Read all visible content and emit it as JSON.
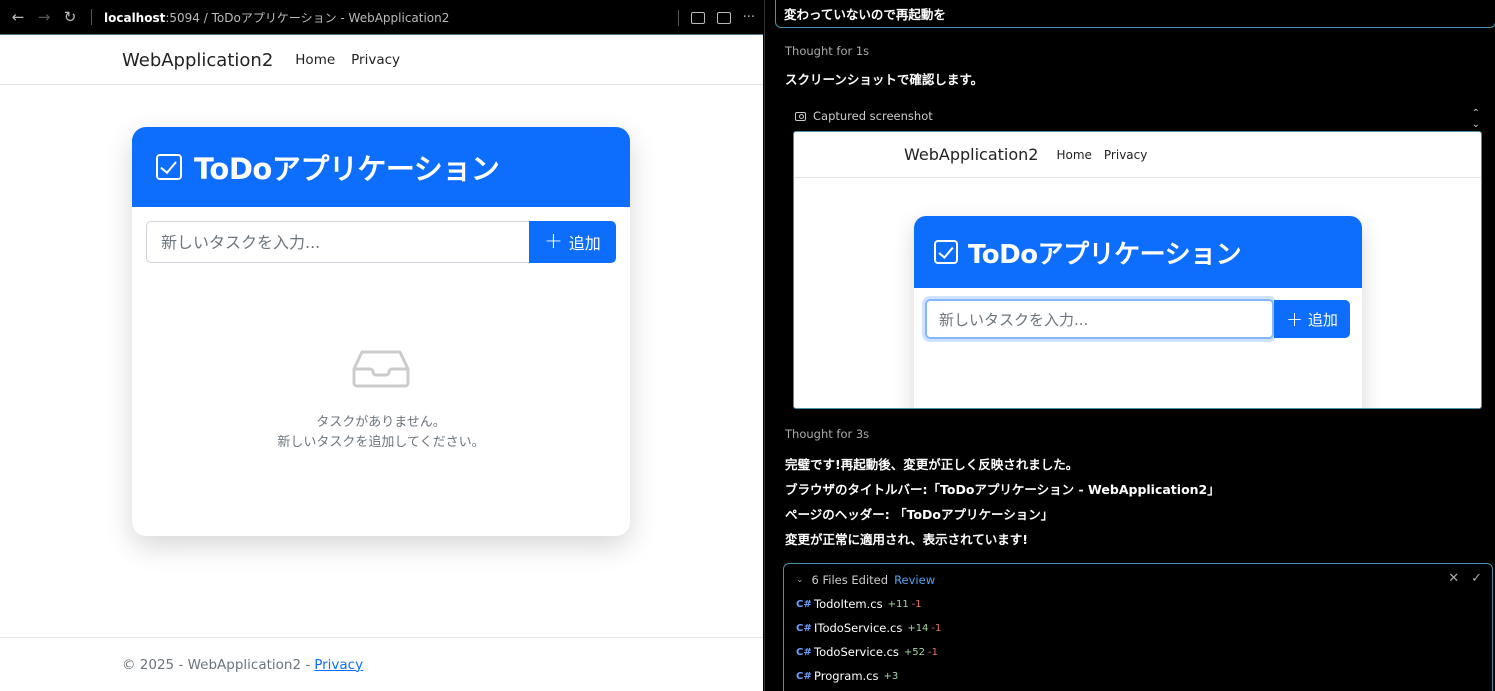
{
  "browser": {
    "url_host": "localhost",
    "url_rest": ":5094 / ToDoアプリケーション - WebApplication2"
  },
  "site": {
    "brand": "WebApplication2",
    "nav": [
      "Home",
      "Privacy"
    ],
    "footer_text": "© 2025 - WebApplication2 -",
    "footer_link": "Privacy"
  },
  "todo": {
    "title": "ToDoアプリケーション",
    "input_placeholder": "新しいタスクを入力...",
    "add_button": "追加",
    "empty_line1": "タスクがありません。",
    "empty_line2": "新しいタスクを追加してください。"
  },
  "chat": {
    "user_message": "変わっていないので再起動を",
    "thought1": "Thought for 1s",
    "para1": "スクリーンショットで確認します。",
    "screenshot_label": "Captured screenshot",
    "thought2": "Thought for 3s",
    "para2": "完璧です!再起動後、変更が正しく反映されました。",
    "para3": "ブラウザのタイトルバー:「ToDoアプリケーション - WebApplication2」",
    "para4": "ページのヘッダー: 「ToDoアプリケーション」",
    "para5": "変更が正常に適用され、表示されています!"
  },
  "files": {
    "summary": "6 Files Edited",
    "review": "Review",
    "items": [
      {
        "name": "TodoItem.cs",
        "added": "+11",
        "removed": "-1"
      },
      {
        "name": "ITodoService.cs",
        "added": "+14",
        "removed": "-1"
      },
      {
        "name": "TodoService.cs",
        "added": "+52",
        "removed": "-1"
      },
      {
        "name": "Program.cs",
        "added": "+3",
        "removed": ""
      }
    ]
  }
}
